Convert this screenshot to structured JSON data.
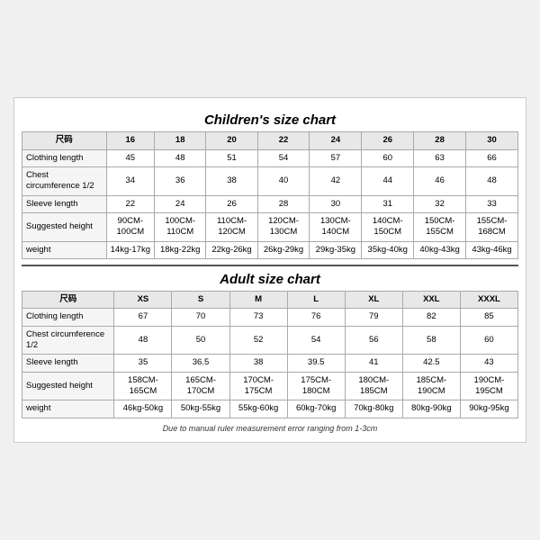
{
  "children_title": "Children's size chart",
  "adult_title": "Adult size chart",
  "footnote": "Due to manual ruler measurement error ranging from 1-3cm",
  "children_table": {
    "headers": [
      "尺码",
      "16",
      "18",
      "20",
      "22",
      "24",
      "26",
      "28",
      "30"
    ],
    "rows": [
      {
        "label": "Clothing length",
        "values": [
          "45",
          "48",
          "51",
          "54",
          "57",
          "60",
          "63",
          "66"
        ]
      },
      {
        "label": "Chest circumference 1/2",
        "values": [
          "34",
          "36",
          "38",
          "40",
          "42",
          "44",
          "46",
          "48"
        ]
      },
      {
        "label": "Sleeve length",
        "values": [
          "22",
          "24",
          "26",
          "28",
          "30",
          "31",
          "32",
          "33"
        ]
      },
      {
        "label": "Suggested height",
        "values": [
          "90CM-100CM",
          "100CM-110CM",
          "110CM-120CM",
          "120CM-130CM",
          "130CM-140CM",
          "140CM-150CM",
          "150CM-155CM",
          "155CM-168CM"
        ]
      },
      {
        "label": "weight",
        "values": [
          "14kg-17kg",
          "18kg-22kg",
          "22kg-26kg",
          "26kg-29kg",
          "29kg-35kg",
          "35kg-40kg",
          "40kg-43kg",
          "43kg-46kg"
        ]
      }
    ]
  },
  "adult_table": {
    "headers": [
      "尺码",
      "XS",
      "S",
      "M",
      "L",
      "XL",
      "XXL",
      "XXXL"
    ],
    "rows": [
      {
        "label": "Clothing length",
        "values": [
          "67",
          "70",
          "73",
          "76",
          "79",
          "82",
          "85"
        ]
      },
      {
        "label": "Chest circumference 1/2",
        "values": [
          "48",
          "50",
          "52",
          "54",
          "56",
          "58",
          "60"
        ]
      },
      {
        "label": "Sleeve length",
        "values": [
          "35",
          "36.5",
          "38",
          "39.5",
          "41",
          "42.5",
          "43"
        ]
      },
      {
        "label": "Suggested height",
        "values": [
          "158CM-165CM",
          "165CM-170CM",
          "170CM-175CM",
          "175CM-180CM",
          "180CM-185CM",
          "185CM-190CM",
          "190CM-195CM"
        ]
      },
      {
        "label": "weight",
        "values": [
          "46kg-50kg",
          "50kg-55kg",
          "55kg-60kg",
          "60kg-70kg",
          "70kg-80kg",
          "80kg-90kg",
          "90kg-95kg"
        ]
      }
    ]
  }
}
